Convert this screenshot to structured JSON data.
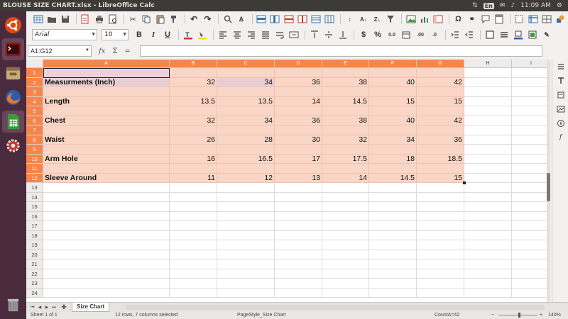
{
  "window": {
    "title": "BLOUSE SIZE CHART.xlsx - LibreOffice Calc"
  },
  "panel": {
    "keyboard": "En",
    "time": "11:09 AM"
  },
  "launcher": {
    "items": [
      "ubuntu-dash",
      "terminal",
      "files",
      "firefox",
      "libreoffice-calc",
      "system-settings",
      "trash"
    ]
  },
  "format_toolbar": {
    "font_name": "Arial",
    "font_size": "10",
    "bold": "B",
    "italic": "I",
    "underline": "U",
    "currency": "$",
    "percent": "%"
  },
  "formula_bar": {
    "name_box": "A1:G12",
    "fx": "fx",
    "sum": "Σ",
    "equals": "=",
    "content": ""
  },
  "grid": {
    "columns": [
      "A",
      "B",
      "C",
      "D",
      "E",
      "F",
      "G",
      "H",
      "I"
    ],
    "rows": [
      "1",
      "2",
      "3",
      "4",
      "5",
      "6",
      "7",
      "8",
      "9",
      "10",
      "11",
      "12",
      "13",
      "14",
      "15",
      "16",
      "17",
      "18",
      "19",
      "20",
      "21",
      "22",
      "23",
      "24"
    ],
    "data": [
      {
        "row": "1",
        "label": "",
        "values": [
          "",
          "",
          "",
          "",
          "",
          ""
        ]
      },
      {
        "row": "2",
        "label": "Measurments (Inch)",
        "values": [
          "32",
          "34",
          "36",
          "38",
          "40",
          "42"
        ]
      },
      {
        "row": "3",
        "label": "",
        "values": [
          "",
          "",
          "",
          "",
          "",
          ""
        ]
      },
      {
        "row": "4",
        "label": "Length",
        "values": [
          "13.5",
          "13.5",
          "14",
          "14.5",
          "15",
          "15"
        ]
      },
      {
        "row": "5",
        "label": "",
        "values": [
          "",
          "",
          "",
          "",
          "",
          ""
        ]
      },
      {
        "row": "6",
        "label": "Chest",
        "values": [
          "32",
          "34",
          "36",
          "38",
          "40",
          "42"
        ]
      },
      {
        "row": "7",
        "label": "",
        "values": [
          "",
          "",
          "",
          "",
          "",
          ""
        ]
      },
      {
        "row": "8",
        "label": "Waist",
        "values": [
          "26",
          "28",
          "30",
          "32",
          "34",
          "36"
        ]
      },
      {
        "row": "9",
        "label": "",
        "values": [
          "",
          "",
          "",
          "",
          "",
          ""
        ]
      },
      {
        "row": "10",
        "label": "Arm Hole",
        "values": [
          "16",
          "16.5",
          "17",
          "17.5",
          "18",
          "18.5"
        ]
      },
      {
        "row": "11",
        "label": "",
        "values": [
          "",
          "",
          "",
          "",
          "",
          ""
        ]
      },
      {
        "row": "12",
        "label": "Sleeve Around",
        "values": [
          "11",
          "12",
          "13",
          "14",
          "14.5",
          "15"
        ]
      }
    ]
  },
  "sheet_tabs": {
    "active": "Size Chart"
  },
  "status_bar": {
    "sheet": "Sheet 1 of 1",
    "selection": "12 rows, 7 columns selected",
    "page_style": "PageStyle_Size Chart",
    "aggregate": "CountA=42",
    "zoom": "140%"
  },
  "colors": {
    "selected_header": "#f6854c",
    "selected_cell": "#f9d6c6",
    "launcher_bg": "#4a2b3e",
    "panel_bg": "#3c3b37"
  }
}
